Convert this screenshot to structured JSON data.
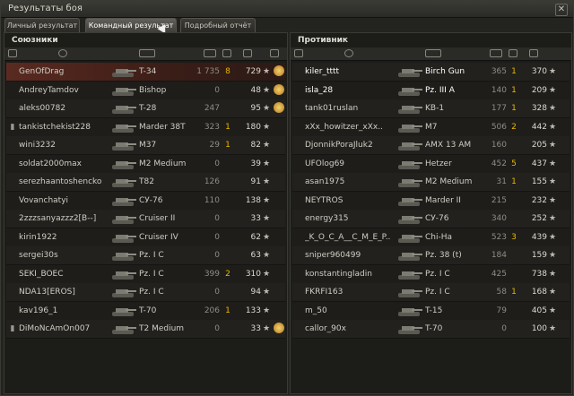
{
  "window": {
    "title": "Результаты боя",
    "close_glyph": "✕"
  },
  "tabs": [
    {
      "label": "Личный результат"
    },
    {
      "label": "Командный результат"
    },
    {
      "label": "Подробный отчёт"
    }
  ],
  "allies": {
    "title": "Союзники",
    "rows": [
      {
        "name": "GenOfDrag",
        "tank": "T-34",
        "dmg": "1 735",
        "frags": "8",
        "xp": "729",
        "star": "★",
        "medal": true
      },
      {
        "name": "AndreyTamdov",
        "tank": "Bishop",
        "dmg": "0",
        "frags": "",
        "xp": "48",
        "star": "★",
        "medal": true
      },
      {
        "name": "aleks00782",
        "tank": "T-28",
        "dmg": "247",
        "frags": "",
        "xp": "95",
        "star": "★",
        "medal": true
      },
      {
        "name": "tankistchekist228",
        "tank": "Marder 38T",
        "dmg": "323",
        "frags": "1",
        "xp": "180",
        "star": "★",
        "medal": false
      },
      {
        "name": "wini3232",
        "tank": "M37",
        "dmg": "29",
        "frags": "1",
        "xp": "82",
        "star": "★",
        "medal": false
      },
      {
        "name": "soldat2000max",
        "tank": "M2 Medium",
        "dmg": "0",
        "frags": "",
        "xp": "39",
        "star": "★",
        "medal": false
      },
      {
        "name": "serezhaantoshencko",
        "tank": "T82",
        "dmg": "126",
        "frags": "",
        "xp": "91",
        "star": "★",
        "medal": false
      },
      {
        "name": "Vovanchatyi",
        "tank": "СУ-76",
        "dmg": "110",
        "frags": "",
        "xp": "138",
        "star": "★",
        "medal": false
      },
      {
        "name": "2zzzsanyazzz2[B--]",
        "tank": "Cruiser II",
        "dmg": "0",
        "frags": "",
        "xp": "33",
        "star": "★",
        "medal": false
      },
      {
        "name": "kirin1922",
        "tank": "Cruiser IV",
        "dmg": "0",
        "frags": "",
        "xp": "62",
        "star": "★",
        "medal": false
      },
      {
        "name": "sergei30s",
        "tank": "Pz. I C",
        "dmg": "0",
        "frags": "",
        "xp": "63",
        "star": "★",
        "medal": false
      },
      {
        "name": "SEKI_BOEC",
        "tank": "Pz. I C",
        "dmg": "399",
        "frags": "2",
        "xp": "310",
        "star": "★",
        "medal": false
      },
      {
        "name": "NDA13[EROS]",
        "tank": "Pz. I C",
        "dmg": "0",
        "frags": "",
        "xp": "94",
        "star": "★",
        "medal": false
      },
      {
        "name": "kav196_1",
        "tank": "T-70",
        "dmg": "206",
        "frags": "1",
        "xp": "133",
        "star": "★",
        "medal": false
      },
      {
        "name": "DiMoNcAmOn007",
        "tank": "T2 Medium",
        "dmg": "0",
        "frags": "",
        "xp": "33",
        "star": "★",
        "medal": true
      }
    ]
  },
  "enemies": {
    "title": "Противник",
    "rows": [
      {
        "name": "kiler_tttt",
        "tank": "Birch Gun",
        "dmg": "365",
        "frags": "1",
        "xp": "370",
        "star": "★"
      },
      {
        "name": "isla_28",
        "tank": "Pz. III A",
        "dmg": "140",
        "frags": "1",
        "xp": "209",
        "star": "★"
      },
      {
        "name": "tank01ruslan",
        "tank": "KB-1",
        "dmg": "177",
        "frags": "1",
        "xp": "328",
        "star": "★"
      },
      {
        "name": "xXx_howitzer_xXx..",
        "tank": "M7",
        "dmg": "506",
        "frags": "2",
        "xp": "442",
        "star": "★"
      },
      {
        "name": "DjonnikPoraJluk2",
        "tank": "AMX 13 AM",
        "dmg": "160",
        "frags": "",
        "xp": "205",
        "star": "★"
      },
      {
        "name": "UFOlog69",
        "tank": "Hetzer",
        "dmg": "452",
        "frags": "5",
        "xp": "437",
        "star": "★"
      },
      {
        "name": "asan1975",
        "tank": "M2 Medium",
        "dmg": "31",
        "frags": "1",
        "xp": "155",
        "star": "★"
      },
      {
        "name": "NEYTROS",
        "tank": "Marder II",
        "dmg": "215",
        "frags": "",
        "xp": "232",
        "star": "★"
      },
      {
        "name": "energy315",
        "tank": "СУ-76",
        "dmg": "340",
        "frags": "",
        "xp": "252",
        "star": "★"
      },
      {
        "name": "_K_O_C_A__C_M_E_P..",
        "tank": "Chi-Ha",
        "dmg": "523",
        "frags": "3",
        "xp": "439",
        "star": "★"
      },
      {
        "name": "sniper960499",
        "tank": "Pz. 38 (t)",
        "dmg": "184",
        "frags": "",
        "xp": "159",
        "star": "★"
      },
      {
        "name": "konstantingladin",
        "tank": "Pz. I C",
        "dmg": "425",
        "frags": "",
        "xp": "738",
        "star": "★"
      },
      {
        "name": "FKRFI163",
        "tank": "Pz. I C",
        "dmg": "58",
        "frags": "1",
        "xp": "168",
        "star": "★"
      },
      {
        "name": "m_50",
        "tank": "T-15",
        "dmg": "79",
        "frags": "",
        "xp": "405",
        "star": "★"
      },
      {
        "name": "callor_90x",
        "tank": "T-70",
        "dmg": "0",
        "frags": "",
        "xp": "100",
        "star": "★"
      }
    ]
  },
  "colors": {
    "me_row": "#5a2a20",
    "frags": "#e8b800",
    "medal": "#f6d16a"
  }
}
